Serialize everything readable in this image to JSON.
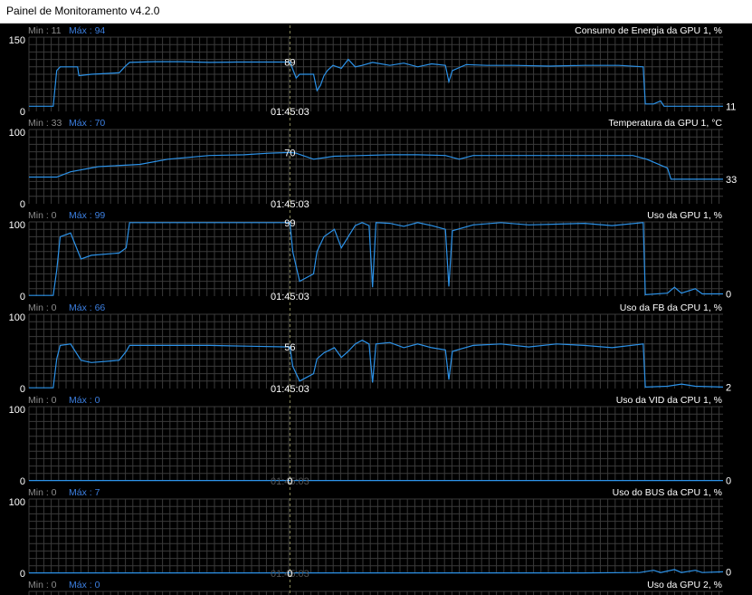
{
  "window": {
    "title": "Painel de Monitoramento v4.2.0"
  },
  "colors": {
    "background": "#000000",
    "grid": "#3a3a3a",
    "line": "#2c92e8",
    "min_label": "#8c8c8c",
    "max_label": "#3c7fe0",
    "text": "#ffffff",
    "cursor": "#8a8a5a",
    "tick_text": "#ffffff"
  },
  "cursor": {
    "time_label": "01:45:03",
    "position": 0.376
  },
  "panels": [
    {
      "name": "Consumo de Energia da GPU 1, %",
      "min_label": "Min : 11",
      "max_label": "Máx : 94",
      "y_max_label": "150",
      "y_min_label": "0",
      "ymax": 150,
      "cursor_value": "89",
      "current_value": "11",
      "time_label_style": "solid",
      "points": [
        [
          0,
          0.07
        ],
        [
          0.035,
          0.07
        ],
        [
          0.04,
          0.55
        ],
        [
          0.045,
          0.6
        ],
        [
          0.07,
          0.6
        ],
        [
          0.072,
          0.48
        ],
        [
          0.09,
          0.5
        ],
        [
          0.13,
          0.52
        ],
        [
          0.138,
          0.6
        ],
        [
          0.145,
          0.66
        ],
        [
          0.18,
          0.67
        ],
        [
          0.22,
          0.67
        ],
        [
          0.26,
          0.66
        ],
        [
          0.3,
          0.665
        ],
        [
          0.345,
          0.665
        ],
        [
          0.376,
          0.665
        ],
        [
          0.385,
          0.45
        ],
        [
          0.39,
          0.5
        ],
        [
          0.41,
          0.5
        ],
        [
          0.415,
          0.28
        ],
        [
          0.42,
          0.35
        ],
        [
          0.425,
          0.48
        ],
        [
          0.43,
          0.55
        ],
        [
          0.438,
          0.62
        ],
        [
          0.45,
          0.58
        ],
        [
          0.46,
          0.7
        ],
        [
          0.47,
          0.6
        ],
        [
          0.48,
          0.62
        ],
        [
          0.495,
          0.66
        ],
        [
          0.52,
          0.62
        ],
        [
          0.54,
          0.65
        ],
        [
          0.56,
          0.6
        ],
        [
          0.58,
          0.64
        ],
        [
          0.6,
          0.62
        ],
        [
          0.605,
          0.4
        ],
        [
          0.61,
          0.55
        ],
        [
          0.63,
          0.63
        ],
        [
          0.66,
          0.62
        ],
        [
          0.7,
          0.62
        ],
        [
          0.75,
          0.61
        ],
        [
          0.8,
          0.62
        ],
        [
          0.85,
          0.62
        ],
        [
          0.885,
          0.6
        ],
        [
          0.888,
          0.1
        ],
        [
          0.9,
          0.1
        ],
        [
          0.91,
          0.14
        ],
        [
          0.915,
          0.07
        ],
        [
          1,
          0.07
        ]
      ]
    },
    {
      "name": "Temperatura da GPU 1, °C",
      "min_label": "Min : 33",
      "max_label": "Máx : 70",
      "y_max_label": "100",
      "y_min_label": "0",
      "ymax": 100,
      "cursor_value": "70",
      "current_value": "33",
      "time_label_style": "solid",
      "points": [
        [
          0,
          0.36
        ],
        [
          0.04,
          0.36
        ],
        [
          0.06,
          0.43
        ],
        [
          0.1,
          0.5
        ],
        [
          0.16,
          0.53
        ],
        [
          0.2,
          0.6
        ],
        [
          0.26,
          0.65
        ],
        [
          0.31,
          0.66
        ],
        [
          0.345,
          0.68
        ],
        [
          0.376,
          0.69
        ],
        [
          0.385,
          0.68
        ],
        [
          0.41,
          0.6
        ],
        [
          0.44,
          0.64
        ],
        [
          0.48,
          0.65
        ],
        [
          0.52,
          0.66
        ],
        [
          0.56,
          0.66
        ],
        [
          0.6,
          0.65
        ],
        [
          0.62,
          0.6
        ],
        [
          0.64,
          0.65
        ],
        [
          0.7,
          0.65
        ],
        [
          0.76,
          0.65
        ],
        [
          0.82,
          0.65
        ],
        [
          0.87,
          0.65
        ],
        [
          0.89,
          0.6
        ],
        [
          0.92,
          0.48
        ],
        [
          0.925,
          0.33
        ],
        [
          1,
          0.33
        ]
      ]
    },
    {
      "name": "Uso da GPU 1, %",
      "min_label": "Min : 0",
      "max_label": "Máx : 99",
      "y_max_label": "100",
      "y_min_label": "0",
      "ymax": 100,
      "cursor_value": "99",
      "current_value": "0",
      "time_label_style": "solid",
      "points": [
        [
          0,
          0.01
        ],
        [
          0.035,
          0.01
        ],
        [
          0.04,
          0.35
        ],
        [
          0.045,
          0.8
        ],
        [
          0.06,
          0.85
        ],
        [
          0.075,
          0.5
        ],
        [
          0.09,
          0.55
        ],
        [
          0.13,
          0.58
        ],
        [
          0.14,
          0.65
        ],
        [
          0.145,
          0.99
        ],
        [
          0.376,
          0.99
        ],
        [
          0.38,
          0.6
        ],
        [
          0.39,
          0.2
        ],
        [
          0.4,
          0.25
        ],
        [
          0.41,
          0.3
        ],
        [
          0.415,
          0.6
        ],
        [
          0.425,
          0.8
        ],
        [
          0.44,
          0.9
        ],
        [
          0.45,
          0.65
        ],
        [
          0.46,
          0.8
        ],
        [
          0.47,
          0.95
        ],
        [
          0.48,
          0.99
        ],
        [
          0.49,
          0.95
        ],
        [
          0.495,
          0.12
        ],
        [
          0.5,
          0.99
        ],
        [
          0.52,
          0.98
        ],
        [
          0.54,
          0.94
        ],
        [
          0.56,
          0.99
        ],
        [
          0.58,
          0.95
        ],
        [
          0.6,
          0.9
        ],
        [
          0.605,
          0.13
        ],
        [
          0.61,
          0.88
        ],
        [
          0.64,
          0.96
        ],
        [
          0.68,
          0.99
        ],
        [
          0.72,
          0.96
        ],
        [
          0.76,
          0.97
        ],
        [
          0.8,
          0.98
        ],
        [
          0.84,
          0.95
        ],
        [
          0.885,
          0.99
        ],
        [
          0.888,
          0.02
        ],
        [
          0.92,
          0.04
        ],
        [
          0.93,
          0.12
        ],
        [
          0.94,
          0.04
        ],
        [
          0.96,
          0.1
        ],
        [
          0.97,
          0.03
        ],
        [
          1,
          0.03
        ]
      ]
    },
    {
      "name": "Uso da FB da CPU 1, %",
      "min_label": "Min : 0",
      "max_label": "Máx : 66",
      "y_max_label": "100",
      "y_min_label": "0",
      "ymax": 100,
      "cursor_value": "56",
      "current_value": "2",
      "time_label_style": "solid",
      "points": [
        [
          0,
          0.01
        ],
        [
          0.035,
          0.01
        ],
        [
          0.04,
          0.4
        ],
        [
          0.045,
          0.58
        ],
        [
          0.06,
          0.6
        ],
        [
          0.075,
          0.38
        ],
        [
          0.09,
          0.35
        ],
        [
          0.13,
          0.38
        ],
        [
          0.14,
          0.5
        ],
        [
          0.145,
          0.58
        ],
        [
          0.2,
          0.58
        ],
        [
          0.26,
          0.58
        ],
        [
          0.32,
          0.57
        ],
        [
          0.376,
          0.56
        ],
        [
          0.38,
          0.3
        ],
        [
          0.39,
          0.1
        ],
        [
          0.4,
          0.15
        ],
        [
          0.41,
          0.2
        ],
        [
          0.415,
          0.4
        ],
        [
          0.425,
          0.48
        ],
        [
          0.44,
          0.55
        ],
        [
          0.45,
          0.42
        ],
        [
          0.46,
          0.5
        ],
        [
          0.47,
          0.6
        ],
        [
          0.48,
          0.65
        ],
        [
          0.49,
          0.6
        ],
        [
          0.495,
          0.08
        ],
        [
          0.5,
          0.6
        ],
        [
          0.52,
          0.62
        ],
        [
          0.54,
          0.55
        ],
        [
          0.56,
          0.6
        ],
        [
          0.58,
          0.55
        ],
        [
          0.6,
          0.52
        ],
        [
          0.605,
          0.12
        ],
        [
          0.61,
          0.5
        ],
        [
          0.64,
          0.58
        ],
        [
          0.68,
          0.6
        ],
        [
          0.72,
          0.56
        ],
        [
          0.76,
          0.6
        ],
        [
          0.8,
          0.58
        ],
        [
          0.84,
          0.55
        ],
        [
          0.885,
          0.6
        ],
        [
          0.888,
          0.02
        ],
        [
          0.92,
          0.03
        ],
        [
          0.94,
          0.06
        ],
        [
          0.96,
          0.03
        ],
        [
          1,
          0.02
        ]
      ]
    },
    {
      "name": "Uso da VID da CPU 1, %",
      "min_label": "Min : 0",
      "max_label": "Máx : 0",
      "y_max_label": "100",
      "y_min_label": "0",
      "ymax": 100,
      "cursor_value": "0",
      "current_value": "0",
      "time_label_style": "faded",
      "points": [
        [
          0,
          0.005
        ],
        [
          1,
          0.005
        ]
      ]
    },
    {
      "name": "Uso do BUS da CPU 1, %",
      "min_label": "Min : 0",
      "max_label": "Máx : 7",
      "y_max_label": "100",
      "y_min_label": "0",
      "ymax": 100,
      "cursor_value": "0",
      "current_value": "0",
      "time_label_style": "faded",
      "points": [
        [
          0,
          0.005
        ],
        [
          0.8,
          0.005
        ],
        [
          0.88,
          0.01
        ],
        [
          0.9,
          0.04
        ],
        [
          0.91,
          0.01
        ],
        [
          0.93,
          0.05
        ],
        [
          0.94,
          0.01
        ],
        [
          0.96,
          0.04
        ],
        [
          0.97,
          0.01
        ],
        [
          1,
          0.02
        ]
      ]
    },
    {
      "name": "Uso da GPU 2, %",
      "min_label": "Min : 0",
      "max_label": "Máx : 0",
      "y_max_label": "",
      "y_min_label": "",
      "ymax": 100,
      "cursor_value": "",
      "current_value": "",
      "time_label_style": "none",
      "points": []
    }
  ]
}
